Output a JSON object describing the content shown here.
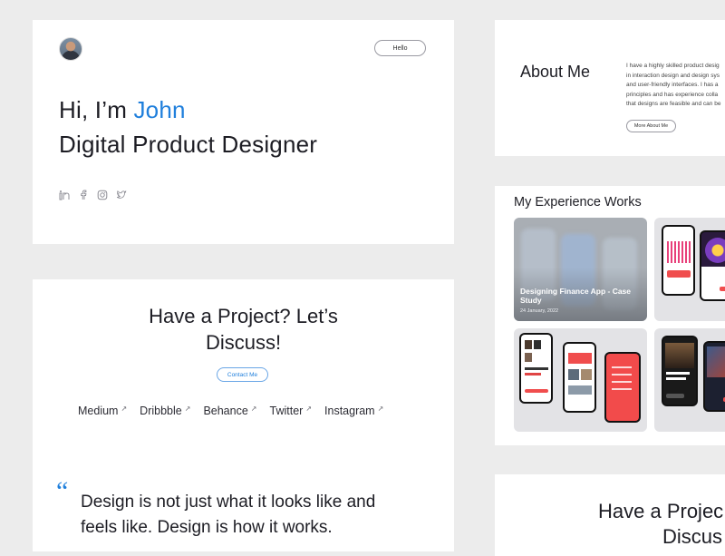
{
  "hero": {
    "hello_label": "Hello",
    "greeting": "Hi, I’m ",
    "name": "John",
    "role": "Digital Product Designer",
    "socials": [
      "linkedin-icon",
      "facebook-icon",
      "instagram-icon",
      "twitter-icon"
    ]
  },
  "project": {
    "title_line1": "Have a Project? Let’s",
    "title_line2": "Discuss!",
    "contact_label": "Contact Me",
    "links": [
      {
        "label": "Medium"
      },
      {
        "label": "Dribbble"
      },
      {
        "label": "Behance"
      },
      {
        "label": "Twitter"
      },
      {
        "label": "Instagram"
      }
    ],
    "quote_line1": "Design is not just what it looks like and",
    "quote_line2": "feels like. Design is how it works."
  },
  "about": {
    "title": "About Me",
    "text_lines": [
      "I have a highly skilled product desig",
      "in interaction design and design sys",
      "and user-friendly interfaces. I has a",
      "principles and has experience colla",
      "that designs are feasible and can be"
    ],
    "button_label": "More About Me"
  },
  "works": {
    "title": "My Experience Works",
    "featured": {
      "title": "Designing Finance App - Case Study",
      "date": "24 January, 2022"
    }
  },
  "project2": {
    "title_line1": "Have a Projec",
    "title_line2": "Discus"
  },
  "colors": {
    "accent": "#1f7fdc",
    "background": "#ececec",
    "card": "#ffffff"
  }
}
